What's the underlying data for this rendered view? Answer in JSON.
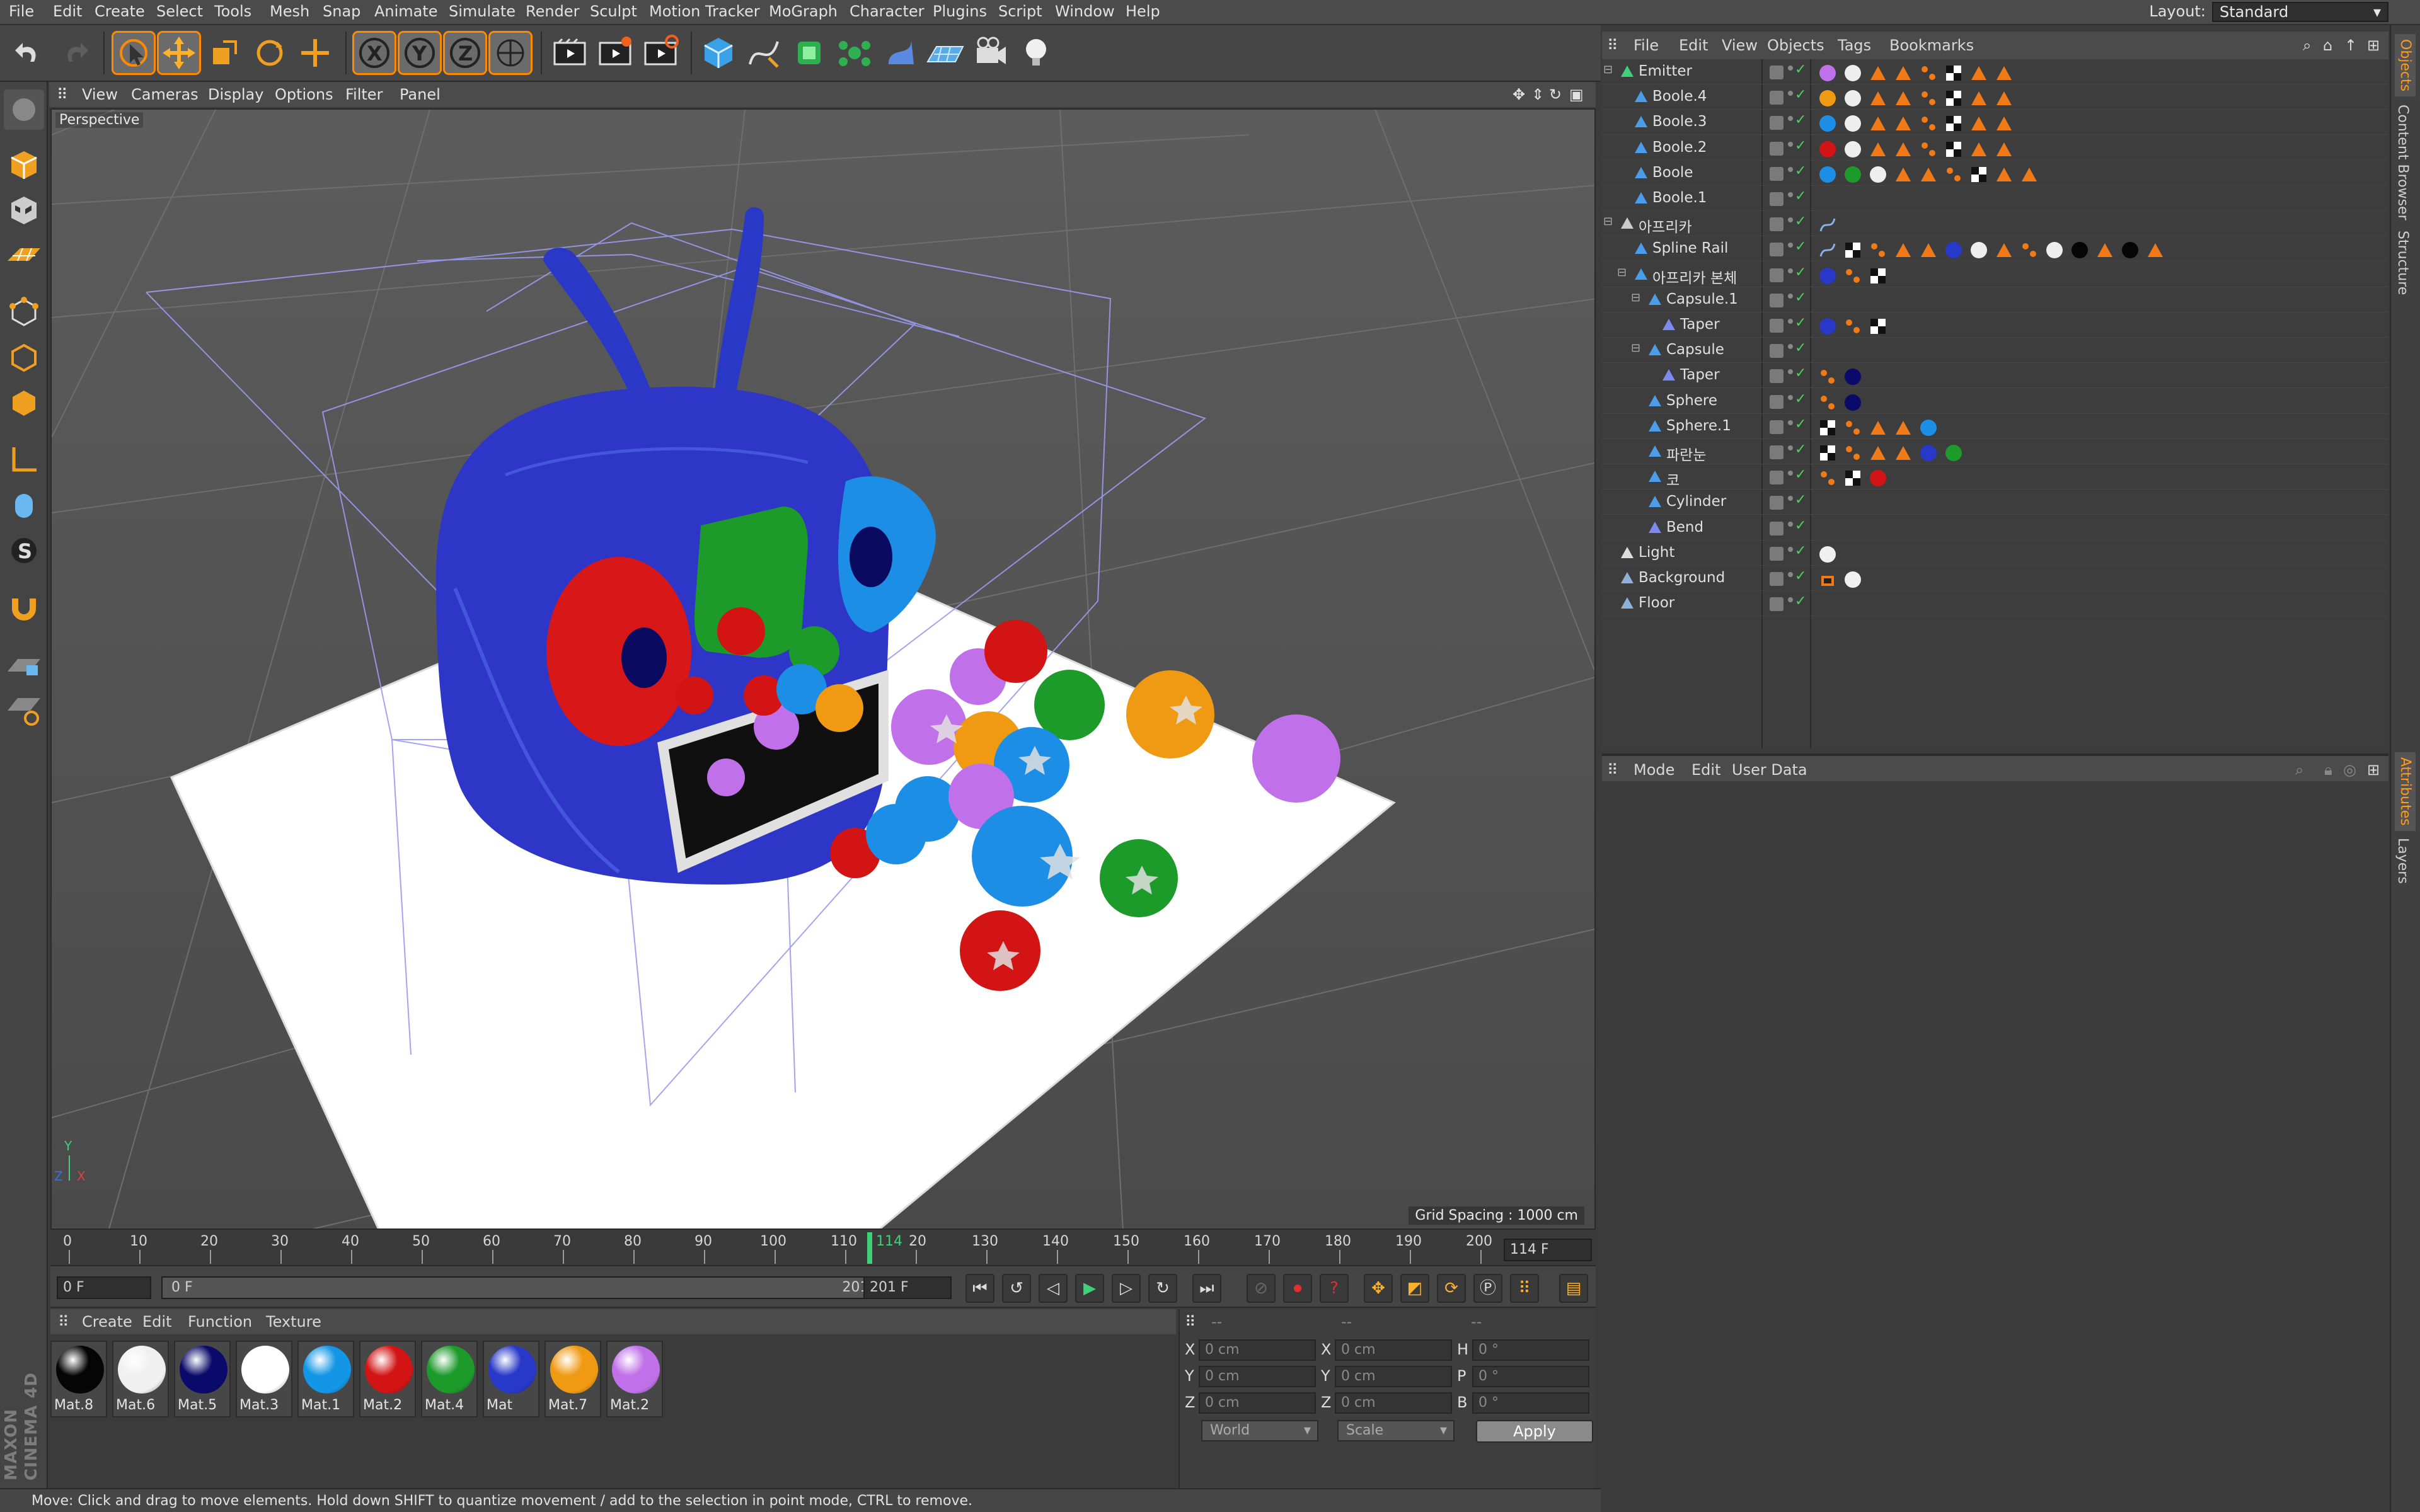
{
  "menu": [
    "File",
    "Edit",
    "Create",
    "Select",
    "Tools",
    "Mesh",
    "Snap",
    "Animate",
    "Simulate",
    "Render",
    "Sculpt",
    "Motion Tracker",
    "MoGraph",
    "Character",
    "Plugins",
    "Script",
    "Window",
    "Help"
  ],
  "layout": {
    "label": "Layout:",
    "value": "Standard"
  },
  "viewport": {
    "menu": [
      "View",
      "Cameras",
      "Display",
      "Options",
      "Filter",
      "Panel"
    ],
    "label": "Perspective",
    "grid_spacing": "Grid Spacing : 1000 cm"
  },
  "timeline": {
    "ticks": [
      "0",
      "10",
      "20",
      "30",
      "40",
      "50",
      "60",
      "70",
      "80",
      "90",
      "100",
      "110",
      "114",
      "20",
      "130",
      "140",
      "150",
      "160",
      "170",
      "180",
      "190",
      "200"
    ],
    "current_frame": "114 F",
    "start_field": "0 F",
    "range_start": "0 F",
    "range_end": "201 F",
    "end_field": "201 F"
  },
  "materials": {
    "menu": [
      "Create",
      "Edit",
      "Function",
      "Texture"
    ],
    "items": [
      {
        "name": "Mat.8",
        "color": "#050505"
      },
      {
        "name": "Mat.6",
        "color": "#f0f0f0"
      },
      {
        "name": "Mat.5",
        "color": "#0a0a6a"
      },
      {
        "name": "Mat.3",
        "color": "#ffffff"
      },
      {
        "name": "Mat.1",
        "color": "#1496e6"
      },
      {
        "name": "Mat.2",
        "color": "#d21414"
      },
      {
        "name": "Mat.4",
        "color": "#1c9a2a"
      },
      {
        "name": "Mat",
        "color": "#2838c8"
      },
      {
        "name": "Mat.7",
        "color": "#f09a14"
      },
      {
        "name": "Mat.2",
        "color": "#c070e8"
      }
    ]
  },
  "coords": {
    "headers": [
      "--",
      "--",
      "--"
    ],
    "rows": [
      {
        "a": "X",
        "av": "0 cm",
        "b": "X",
        "bv": "0 cm",
        "c": "H",
        "cv": "0 °"
      },
      {
        "a": "Y",
        "av": "0 cm",
        "b": "Y",
        "bv": "0 cm",
        "c": "P",
        "cv": "0 °"
      },
      {
        "a": "Z",
        "av": "0 cm",
        "b": "Z",
        "bv": "0 cm",
        "c": "B",
        "cv": "0 °"
      }
    ],
    "space": "World",
    "mode": "Scale",
    "apply": "Apply"
  },
  "objects": {
    "menu": [
      "File",
      "Edit",
      "View",
      "Objects",
      "Tags",
      "Bookmarks"
    ],
    "rows": [
      {
        "name": "Emitter",
        "indent": 0,
        "icon": "emitter"
      },
      {
        "name": "Boole.4",
        "indent": 1,
        "icon": "boole"
      },
      {
        "name": "Boole.3",
        "indent": 1,
        "icon": "boole"
      },
      {
        "name": "Boole.2",
        "indent": 1,
        "icon": "boole"
      },
      {
        "name": "Boole",
        "indent": 1,
        "icon": "boole"
      },
      {
        "name": "Boole.1",
        "indent": 1,
        "icon": "boole"
      },
      {
        "name": "아프리카",
        "indent": 0,
        "icon": "null"
      },
      {
        "name": "Spline Rail",
        "indent": 1,
        "icon": "spline"
      },
      {
        "name": "아프리카 본체",
        "indent": 1,
        "icon": "boole"
      },
      {
        "name": "Capsule.1",
        "indent": 2,
        "icon": "boole"
      },
      {
        "name": "Taper",
        "indent": 3,
        "icon": "deformer"
      },
      {
        "name": "Capsule",
        "indent": 2,
        "icon": "boole"
      },
      {
        "name": "Taper",
        "indent": 3,
        "icon": "deformer"
      },
      {
        "name": "Sphere",
        "indent": 2,
        "icon": "sphere"
      },
      {
        "name": "Sphere.1",
        "indent": 2,
        "icon": "sphere"
      },
      {
        "name": "파란눈",
        "indent": 2,
        "icon": "boole"
      },
      {
        "name": "코",
        "indent": 2,
        "icon": "boole"
      },
      {
        "name": "Cylinder",
        "indent": 2,
        "icon": "boole"
      },
      {
        "name": "Bend",
        "indent": 2,
        "icon": "deformer"
      },
      {
        "name": "Light",
        "indent": 0,
        "icon": "light"
      },
      {
        "name": "Background",
        "indent": 0,
        "icon": "background"
      },
      {
        "name": "Floor",
        "indent": 0,
        "icon": "floor"
      }
    ]
  },
  "attributes": {
    "menu": [
      "Mode",
      "Edit",
      "User Data"
    ]
  },
  "right_tabs": [
    "Objects",
    "Content Browser",
    "Structure",
    "Attributes",
    "Layers"
  ],
  "status": "Move: Click and drag to move elements. Hold down SHIFT to quantize movement / add to the selection in point mode, CTRL to remove.",
  "logo": {
    "line1": "MAXON",
    "line2": "CINEMA 4D"
  },
  "colors": {
    "accent": "#ff8a00",
    "check": "#4cd15f",
    "playhead": "#3fd07a"
  }
}
